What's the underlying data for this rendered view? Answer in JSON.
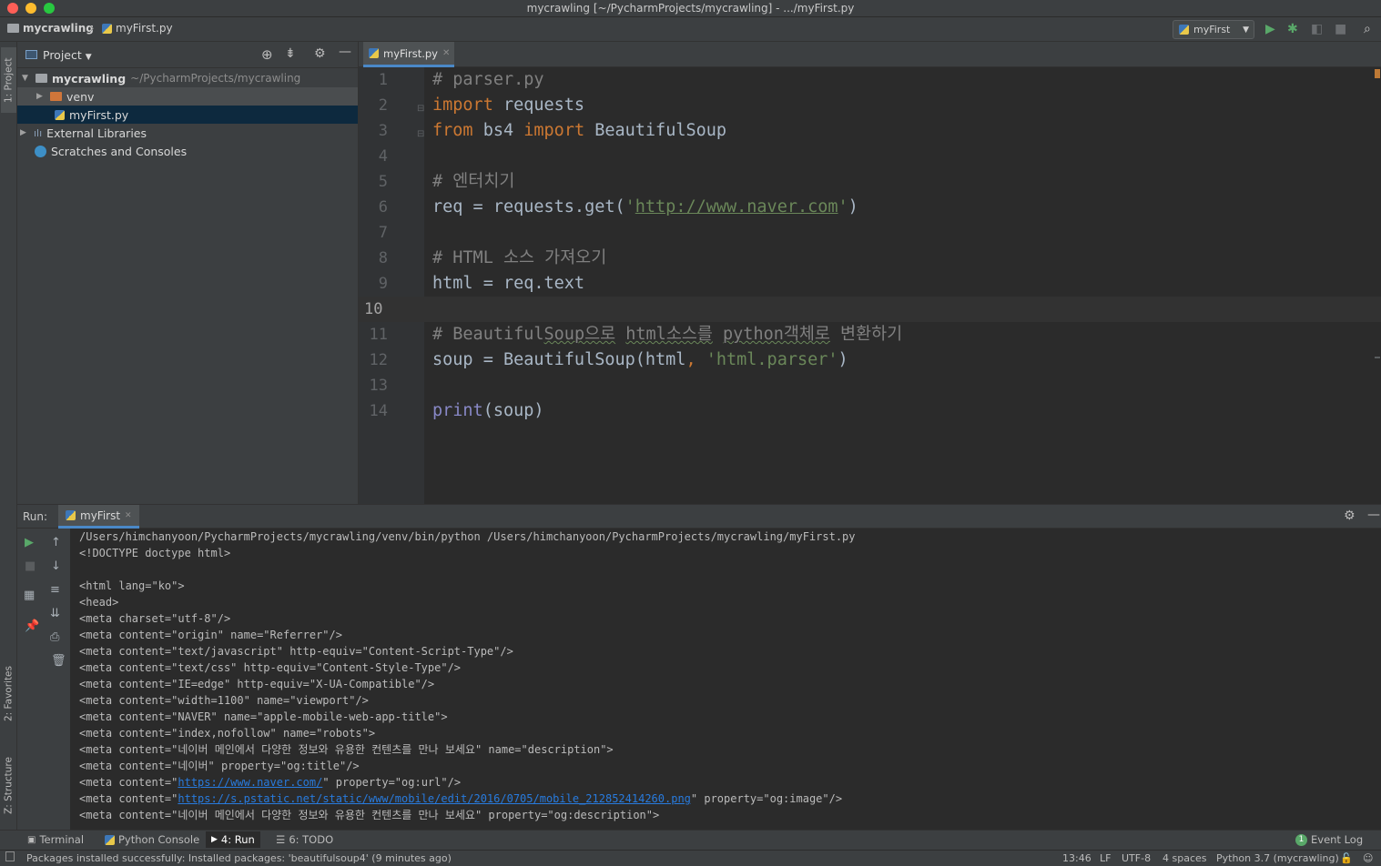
{
  "window": {
    "title": "mycrawling [~/PycharmProjects/mycrawling] - .../myFirst.py"
  },
  "navbar": {
    "project": "mycrawling",
    "file": "myFirst.py",
    "run_config": "myFirst"
  },
  "tool_tabs": {
    "project": "1: Project",
    "favorites": "2: Favorites",
    "structure": "Z: Structure"
  },
  "project_panel": {
    "title": "Project",
    "tree": [
      {
        "label": "mycrawling",
        "path": "~/PycharmProjects/mycrawling"
      },
      {
        "label": "venv"
      },
      {
        "label": "myFirst.py"
      },
      {
        "label": "External Libraries"
      },
      {
        "label": "Scratches and Consoles"
      }
    ]
  },
  "editor": {
    "tab": "myFirst.py",
    "current_line": 10,
    "lines": [
      "1",
      "2",
      "3",
      "4",
      "5",
      "6",
      "7",
      "8",
      "9",
      "10",
      "11",
      "12",
      "13",
      "14"
    ]
  },
  "code": {
    "l1": "# parser.py",
    "l2_kw": "import",
    "l2_rest": " requests",
    "l3_kw1": "from",
    "l3_mod": " bs4 ",
    "l3_kw2": "import",
    "l3_rest": " BeautifulSoup",
    "l5": "# 엔터치기",
    "l6_pre": "req = requests.get(",
    "l6_q1": "'",
    "l6_url": "http://www.naver.com",
    "l6_q2": "'",
    "l6_post": ")",
    "l8": "# HTML 소스 가져오기",
    "l9": "html = req.text",
    "l11_a": "# Beautiful",
    "l11_b": "Soup으로",
    "l11_c": " ",
    "l11_d": "html소스를",
    "l11_e": " ",
    "l11_f": "python객체로",
    "l11_g": " 변환하기",
    "l12_pre": "soup = BeautifulSoup(html",
    "l12_comma": ",",
    "l12_sp": " ",
    "l12_str": "'html.parser'",
    "l12_post": ")",
    "l14_fn": "print",
    "l14_rest": "(soup)"
  },
  "run_panel": {
    "label": "Run:",
    "tab": "myFirst",
    "output": [
      "/Users/himchanyoon/PycharmProjects/mycrawling/venv/bin/python /Users/himchanyoon/PycharmProjects/mycrawling/myFirst.py",
      "<!DOCTYPE doctype html>",
      "",
      "<html lang=\"ko\">",
      "<head>",
      "<meta charset=\"utf-8\"/>",
      "<meta content=\"origin\" name=\"Referrer\"/>",
      "<meta content=\"text/javascript\" http-equiv=\"Content-Script-Type\"/>",
      "<meta content=\"text/css\" http-equiv=\"Content-Style-Type\"/>",
      "<meta content=\"IE=edge\" http-equiv=\"X-UA-Compatible\"/>",
      "<meta content=\"width=1100\" name=\"viewport\"/>",
      "<meta content=\"NAVER\" name=\"apple-mobile-web-app-title\">",
      "<meta content=\"index,nofollow\" name=\"robots\">",
      "<meta content=\"네이버 메인에서 다양한 정보와 유용한 컨텐츠를 만나 보세요\" name=\"description\">",
      "<meta content=\"네이버\" property=\"og:title\"/>"
    ],
    "og_url": {
      "pre": "<meta content=\"",
      "link": "https://www.naver.com/",
      "post": "\" property=\"og:url\"/>"
    },
    "og_image": {
      "pre": "<meta content=\"",
      "link": "https://s.pstatic.net/static/www/mobile/edit/2016/0705/mobile_212852414260.png",
      "post": "\" property=\"og:image\"/>"
    },
    "og_desc": "<meta content=\"네이버 메인에서 다양한 정보와 유용한 컨텐츠를 만나 보세요\" property=\"og:description\">"
  },
  "bottom_toolbar": {
    "terminal": "Terminal",
    "python_console": "Python Console",
    "run": "4: Run",
    "todo": "6: TODO",
    "event_log": "Event Log",
    "event_count": "1"
  },
  "status": {
    "message": "Packages installed successfully: Installed packages: 'beautifulsoup4' (9 minutes ago)",
    "position": "13:46",
    "line_sep": "LF",
    "encoding": "UTF-8",
    "indent": "4 spaces",
    "interpreter": "Python 3.7 (mycrawling)"
  },
  "colors": {
    "accent": "#4a88c7",
    "run_green": "#59a869",
    "keyword": "#cc7832",
    "string": "#6a8759",
    "comment": "#808080"
  }
}
